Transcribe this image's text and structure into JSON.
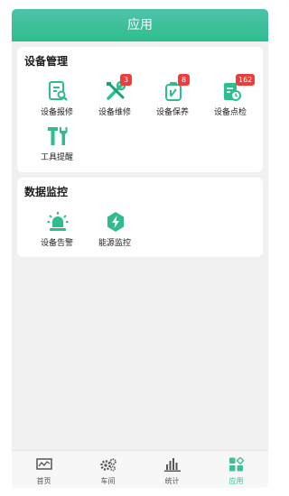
{
  "header": {
    "title": "应用"
  },
  "device_management": {
    "title": "设备管理",
    "items": [
      {
        "label": "设备报修",
        "icon": "repair-report-icon",
        "badge": ""
      },
      {
        "label": "设备维修",
        "icon": "maintenance-tools-icon",
        "badge": "3"
      },
      {
        "label": "设备保养",
        "icon": "upkeep-icon",
        "badge": "8"
      },
      {
        "label": "设备点检",
        "icon": "inspection-icon",
        "badge": "162"
      },
      {
        "label": "工具提醒",
        "icon": "tool-reminder-icon",
        "badge": ""
      }
    ]
  },
  "data_monitoring": {
    "title": "数据监控",
    "items": [
      {
        "label": "设备告警",
        "icon": "alarm-siren-icon"
      },
      {
        "label": "能源监控",
        "icon": "energy-bolt-icon"
      }
    ]
  },
  "tabbar": {
    "tabs": [
      {
        "label": "首页",
        "icon": "chart-home-icon"
      },
      {
        "label": "车间",
        "icon": "gears-icon"
      },
      {
        "label": "统计",
        "icon": "bar-stats-icon"
      },
      {
        "label": "应用",
        "icon": "apps-grid-icon",
        "active": true
      }
    ]
  },
  "colors": {
    "accent": "#3ebf9a",
    "badge": "#ee3b3b",
    "header_top": "#4ec3a9",
    "header_bottom": "#2fbd8f"
  }
}
